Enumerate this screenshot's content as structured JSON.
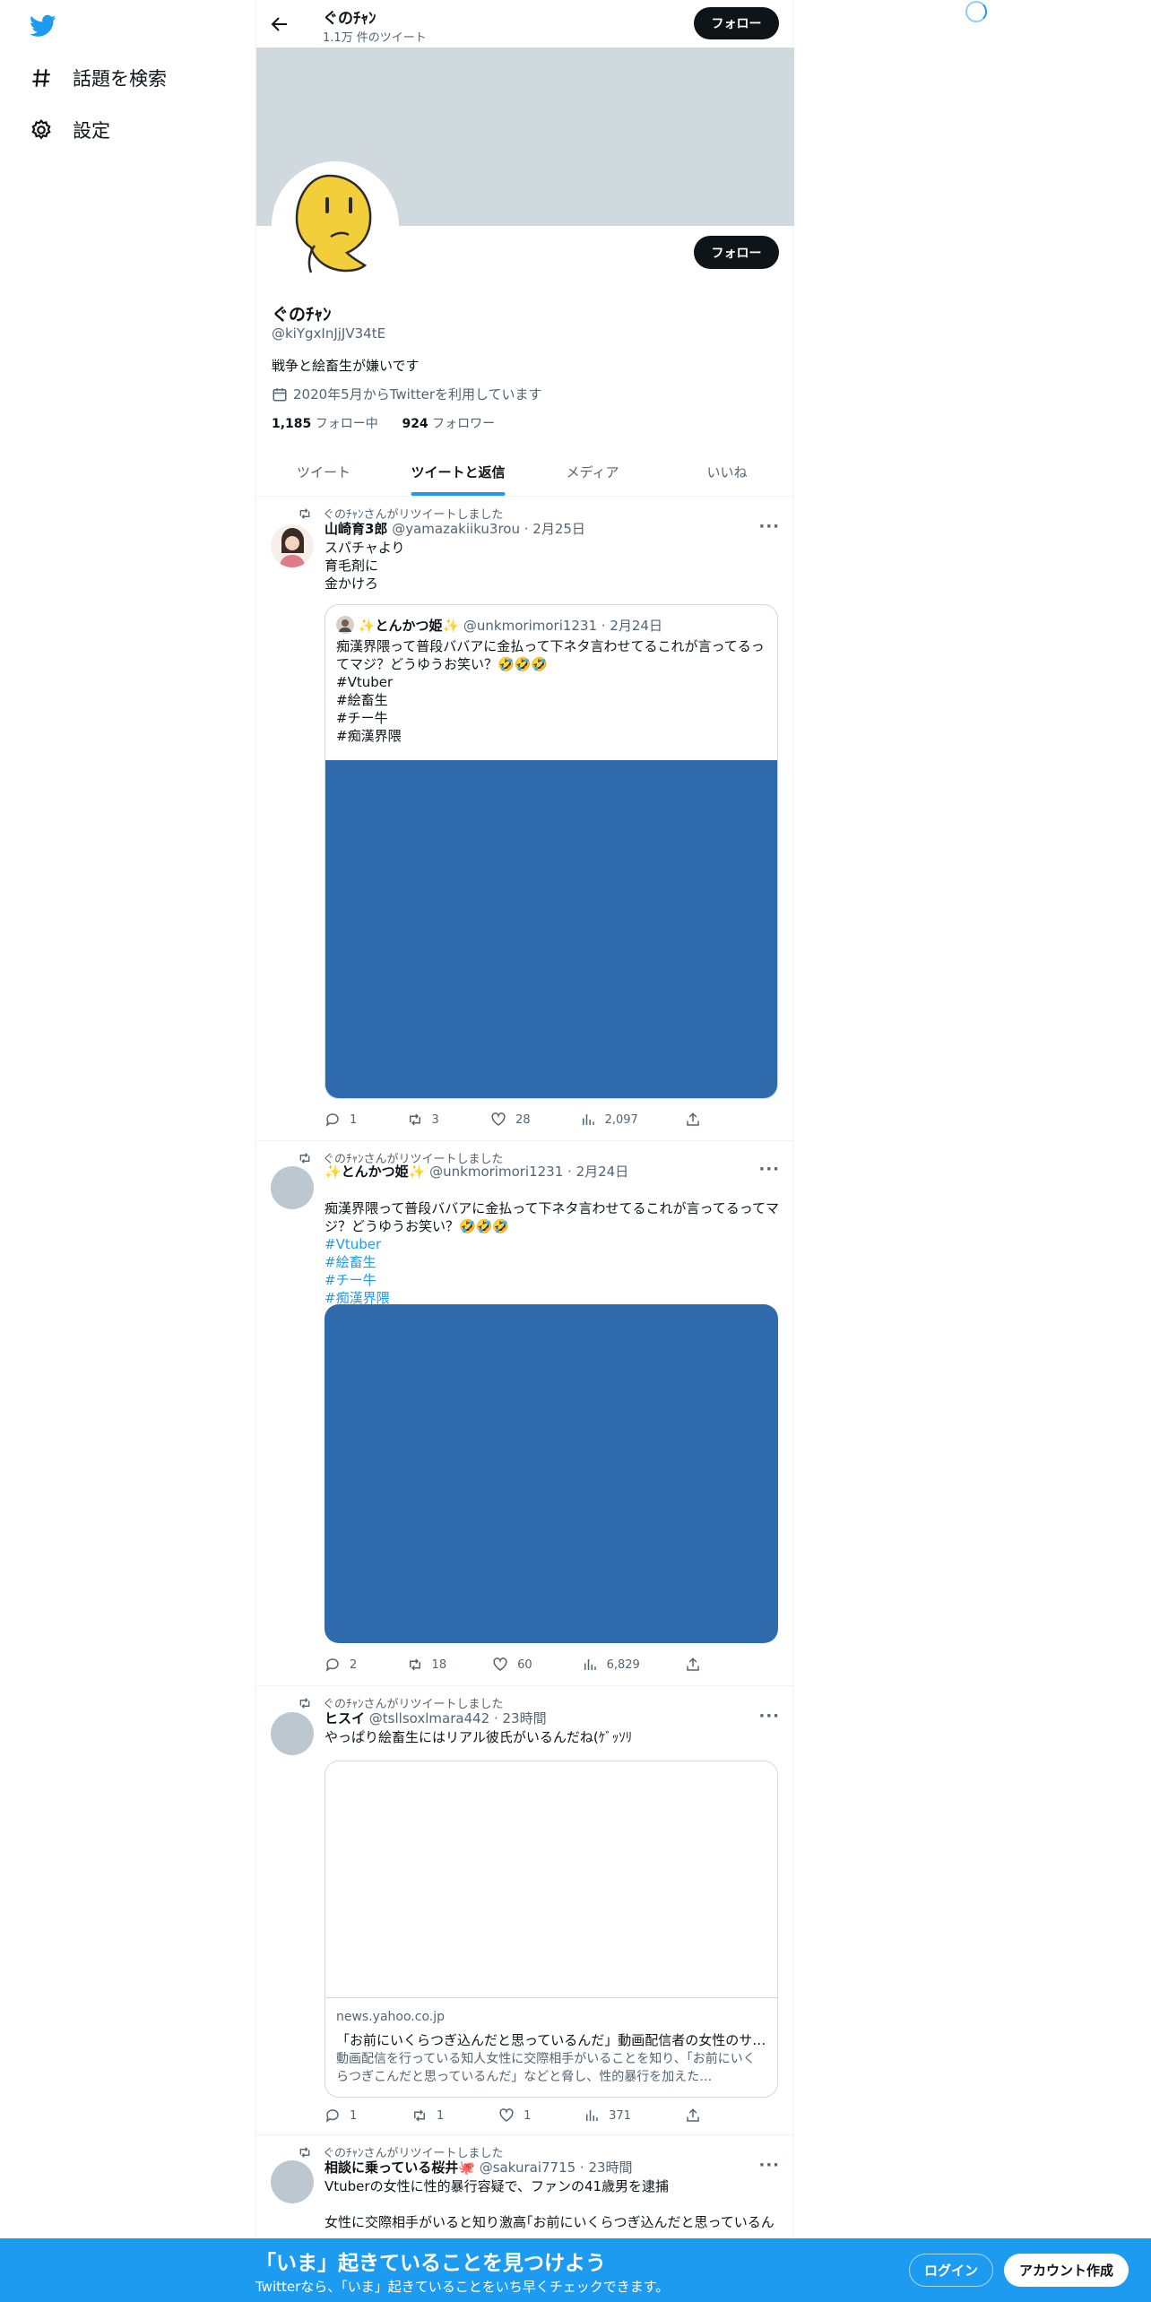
{
  "nav": {
    "explore": "話題を検索",
    "settings": "設定"
  },
  "header": {
    "name": "ぐのﾁｬﾝ",
    "tweet_count": "1.1万 件のツイート",
    "follow": "フォロー"
  },
  "profile": {
    "follow": "フォロー",
    "name": "ぐのﾁｬﾝ",
    "handle": "@kiYgxInJjJV34tE",
    "bio": "戦争と絵畜生が嫌いです",
    "joined": "2020年5月からTwitterを利用しています",
    "following_count": "1,185",
    "following_label": "フォロー中",
    "followers_count": "924",
    "followers_label": "フォロワー"
  },
  "tabs": [
    "ツイート",
    "ツイートと返信",
    "メディア",
    "いいね"
  ],
  "tweets": [
    {
      "retweeted_by": "ぐのﾁｬﾝさんがリツイートしました",
      "name": "山崎育3郎",
      "handle_time": "@yamazakiiku3rou · 2月25日",
      "text": "スパチャより\n育毛剤に\n金かけろ",
      "quote": {
        "name": "✨とんかつ姫✨",
        "handle_time": "@unkmorimori1231 · 2月24日",
        "text": "痴漢界隈って普段ババアに金払って下ネタ言わせてるこれが言ってるってマジ？どうゆうお笑い？🤣🤣🤣\n#Vtuber\n#絵畜生\n#チー牛\n#痴漢界隈"
      },
      "replies": "1",
      "retweets": "3",
      "likes": "28",
      "views": "2,097"
    },
    {
      "retweeted_by": "ぐのﾁｬﾝさんがリツイートしました",
      "name": "✨とんかつ姫✨",
      "handle_time": "@unkmorimori1231 · 2月24日",
      "text": "痴漢界隈って普段ババアに金払って下ネタ言わせてるこれが言ってるってマジ？どうゆうお笑い？🤣🤣🤣",
      "hashtags": [
        "#Vtuber",
        "#絵畜生",
        "#チー牛",
        "#痴漢界隈"
      ],
      "replies": "2",
      "retweets": "18",
      "likes": "60",
      "views": "6,829"
    },
    {
      "retweeted_by": "ぐのﾁｬﾝさんがリツイートしました",
      "name": "ヒスイ",
      "handle_time": "@tsllsoxlmara442 · 23時間",
      "text": "やっぱり絵畜生にはリアル彼氏がいるんだね(ｹﾞｯｿﾘ",
      "card": {
        "domain": "news.yahoo.co.jp",
        "title": "「お前にいくらつぎ込んだと思っているんだ」動画配信者の女性のサ…",
        "desc": "動画配信を行っている知人女性に交際相手がいることを知り、「お前にいくらつぎこんだと思っているんだ」などと脅し、性的暴行を加えた…"
      },
      "replies": "1",
      "retweets": "1",
      "likes": "1",
      "views": "371"
    },
    {
      "retweeted_by": "ぐのﾁｬﾝさんがリツイートしました",
      "name": "相談に乗っている桜井🐙",
      "handle_time": "@sakurai7715 · 23時間",
      "text": "Vtuberの女性に性的暴行容疑で、ファンの41歳男を逮捕\n\n女性に交際相手がいると知り激高｢お前にいくらつぎ込んだと思っているん"
    }
  ],
  "bottom_bar": {
    "title": "「いま」起きていることを見つけよう",
    "subtitle": "Twitterなら、「いま」起きていることをいち早くチェックできます。",
    "login": "ログイン",
    "signup": "アカウント作成"
  }
}
